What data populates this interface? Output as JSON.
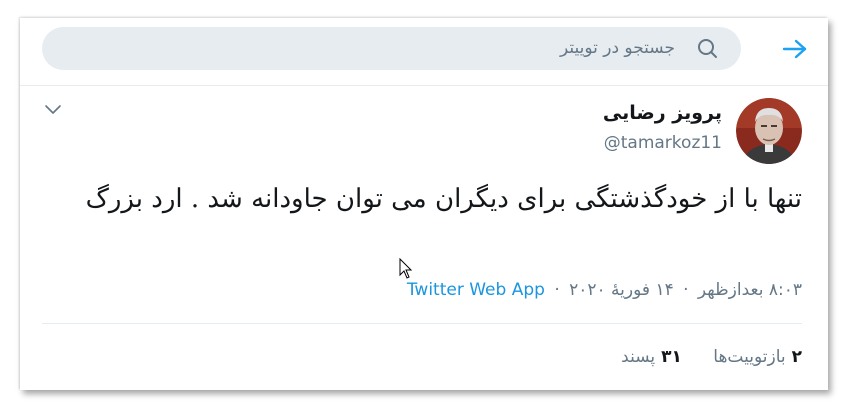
{
  "search": {
    "placeholder": "جستجو در توییتر"
  },
  "tweet": {
    "author_name": "پرویز رضایی",
    "author_handle": "@tamarkoz11",
    "text": "تنها با از خودگذشتگی برای دیگران می توان جاودانه شد . ارد بزرگ",
    "time": "۸:۰۳ بعدازظهر",
    "date": "۱۴ فوریهٔ ۲۰۲۰",
    "separator": "·",
    "source": "Twitter Web App"
  },
  "stats": {
    "retweets_count": "۲",
    "retweets_label": "بازتوییت‌ها",
    "likes_count": "۳۱",
    "likes_label": "پسند"
  },
  "colors": {
    "accent": "#1b95e0",
    "secondary_text": "#657786",
    "search_bg": "#e6ecf0"
  },
  "icons": {
    "back": "back-arrow-icon",
    "search": "search-icon",
    "menu": "chevron-down-icon"
  }
}
